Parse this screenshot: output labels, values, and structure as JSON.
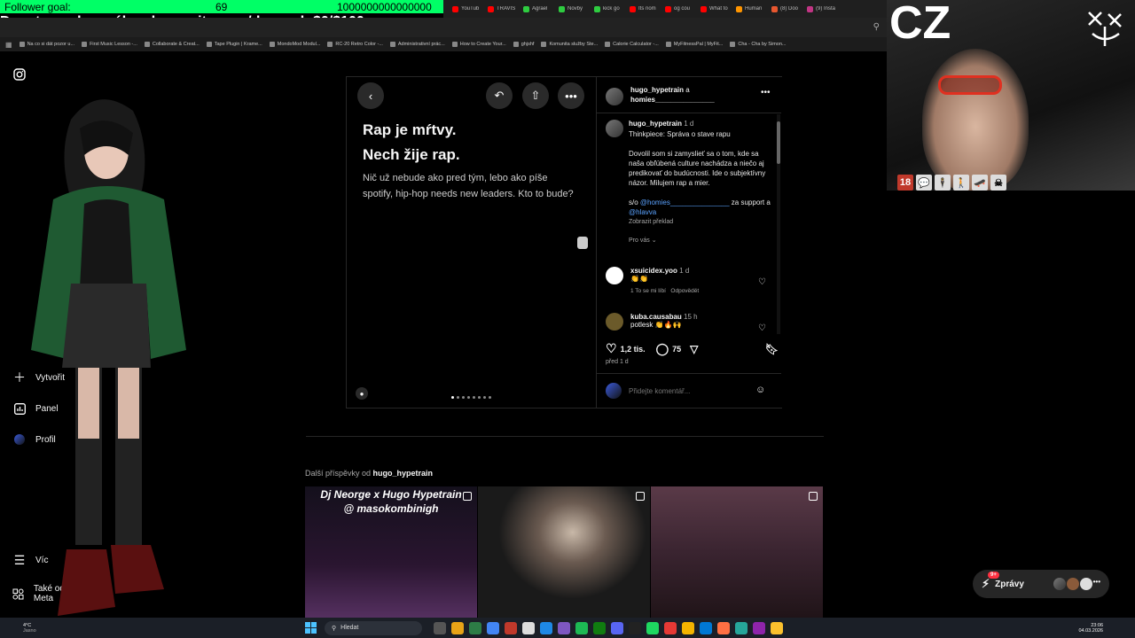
{
  "overlay": {
    "follower_label": "Follower goal:",
    "follower_count": "69",
    "follower_target": "1000000000000000",
    "donate_text": "Donate goal na nákup komunita.com/deynyel: $0/$100",
    "webcam_label": "CZ",
    "emotes": [
      "18",
      "💬",
      "🕴",
      "🚶",
      "🛹",
      "☠"
    ]
  },
  "browser": {
    "tabs": [
      {
        "label": "YouTub",
        "color": "#ff0000"
      },
      {
        "label": "TRAVIS",
        "color": "#ff0000"
      },
      {
        "label": "Agrael",
        "color": "#2ecc40"
      },
      {
        "label": "Novby",
        "color": "#2ecc40"
      },
      {
        "label": "kick go",
        "color": "#2ecc40"
      },
      {
        "label": "Its nom",
        "color": "#ff0000"
      },
      {
        "label": "og cou",
        "color": "#ff0000"
      },
      {
        "label": "What to",
        "color": "#ff0000"
      },
      {
        "label": "Human",
        "color": "#ff9500"
      },
      {
        "label": "(8) Doo",
        "color": "#e8572f"
      },
      {
        "label": "(9) Insta",
        "color": "#c13584"
      }
    ],
    "bookmarks": [
      "Na co si dát pozor u...",
      "First Music Lesson -...",
      "Collaborate & Creat...",
      "Tape Plugin | Krame...",
      "MondoMod Modul...",
      "RC-20 Retro Color -...",
      "Administrativní prác...",
      "How to Create Your...",
      "ghjshf",
      "Komunita služby Ste...",
      "Calorie Calculator -...",
      "MyFitnessPal | MyFit...",
      "Cha - Cha by Simon..."
    ]
  },
  "sidebar": {
    "instagram_icon": "instagram-icon",
    "items": [
      {
        "label": "Vytvořit",
        "icon": "plus-icon"
      },
      {
        "label": "Panel",
        "icon": "chart-icon"
      },
      {
        "label": "Profil",
        "icon": "profile-icon"
      },
      {
        "label": "Víc",
        "icon": "menu-icon"
      },
      {
        "label": "Také od Meta",
        "icon": "grid-icon"
      }
    ]
  },
  "post": {
    "title_line1": "Rap je mŕtvy.",
    "title_line2": "Nech žije rap.",
    "body": "Nič už nebude ako pred tým, lebo ako píše spotify, hip-hop needs new leaders. Kto to bude?",
    "slide_count": 8,
    "active_slide": 1
  },
  "post_side": {
    "header_user": "hugo_hypetrain",
    "header_and": "a",
    "header_coauthor": "homies_______________",
    "caption_user": "hugo_hypetrain",
    "caption_time": "1 d",
    "caption_title": "Thinkpiece: Správa o stave rapu",
    "caption_body": "Dovolil som si zamyslieť sa o tom, kde sa naša obľúbená culture nachádza a niečo aj predikovať do budúcnosti. Ide o subjektívny názor. Milujem rap a mier.",
    "caption_so": "s/o",
    "caption_mention1": "@homies_______________",
    "caption_support": "za support a",
    "caption_mention2": "@hlavva",
    "translate": "Zobrazit překlad",
    "for_you": "Pro vás",
    "comments": [
      {
        "user": "xsuicidex.yoo",
        "time": "1 d",
        "text": "👏👏",
        "meta_likes": "1 To se mi líbí",
        "meta_reply": "Odpovědět"
      },
      {
        "user": "kuba.causabau",
        "time": "15 h",
        "text": "potlesk 👏🔥🙌"
      }
    ],
    "likes": "1,2 tis.",
    "comments_count": "75",
    "posted": "před 1 d",
    "comment_placeholder": "Přidejte komentář..."
  },
  "more_posts": {
    "label_prefix": "Další příspěvky od",
    "label_user": "hugo_hypetrain",
    "thumb1_line1": "Dj Neorge x Hugo Hypetrain",
    "thumb1_line2": "@ masokombinigh"
  },
  "messages": {
    "label": "Zprávy",
    "badge": "9+"
  },
  "taskbar": {
    "search": "Hledat",
    "weather_temp": "4°C",
    "weather_desc": "Jasno",
    "time": "23:06",
    "date": "04.03.2026"
  }
}
